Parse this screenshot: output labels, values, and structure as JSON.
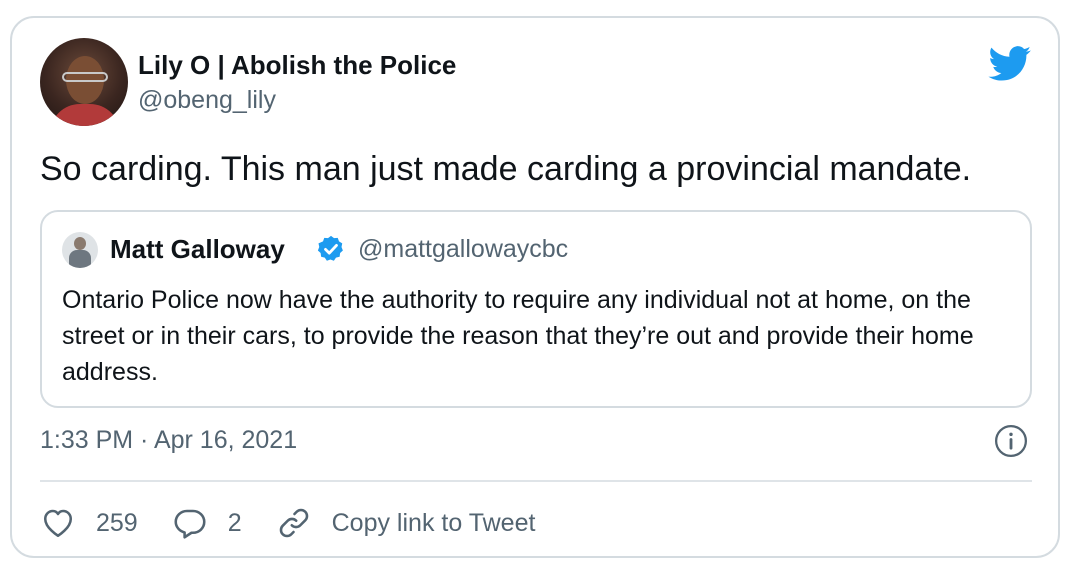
{
  "author": {
    "display_name": "Lily O | Abolish the Police",
    "handle": "@obeng_lily"
  },
  "brand": {
    "icon": "twitter-bird-icon",
    "color": "#1d9bf0"
  },
  "tweet": {
    "text": "So carding. This man just made carding a provincial mandate."
  },
  "quoted_tweet": {
    "display_name": "Matt Galloway",
    "verified_icon": "verified-badge-icon",
    "handle": "@mattgallowaycbc",
    "text": "Ontario Police now have the authority to require any individual not at home, on the street or in their cars, to provide the reason that they’re out and provide their home address."
  },
  "meta": {
    "timestamp": "1:33 PM · Apr 16, 2021",
    "info_icon": "info-icon"
  },
  "actions": {
    "like_count": "259",
    "reply_count": "2",
    "copy_link_label": "Copy link to Tweet"
  },
  "colors": {
    "text_primary": "#0f1419",
    "text_secondary": "#536471",
    "border": "#d4dbe0",
    "verified": "#1d9bf0"
  }
}
